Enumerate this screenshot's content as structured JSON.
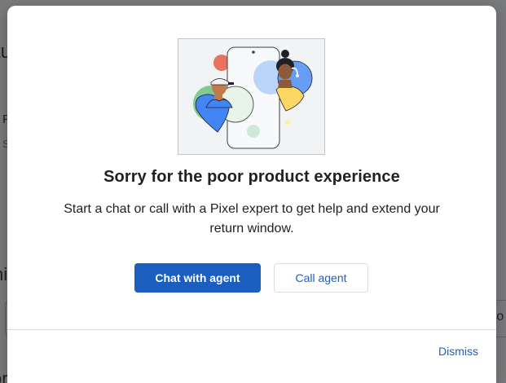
{
  "background": {
    "title_fragment": "tu",
    "item_a_fragment": "F",
    "item_b_fragment": "S",
    "heading_fragment": "ni",
    "input_fragment": "ro",
    "bottom_fragment": "ory"
  },
  "dialog": {
    "title": "Sorry for the poor product experience",
    "body": "Start a chat or call with a Pixel expert to get help and extend your return window.",
    "primary_button": "Chat with agent",
    "secondary_button": "Call agent",
    "dismiss": "Dismiss"
  },
  "colors": {
    "accent": "#1a5fc0",
    "overlay": "#202124"
  },
  "icons": {
    "illustration": "support-agents-phone-illustration"
  }
}
